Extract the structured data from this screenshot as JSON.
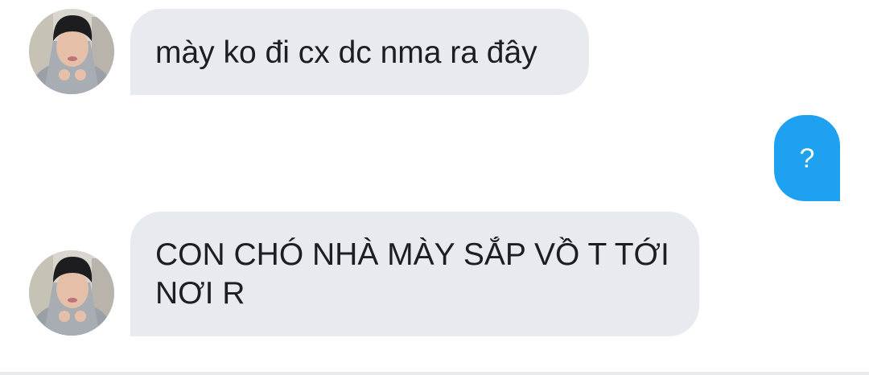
{
  "conversation": {
    "messages": [
      {
        "direction": "incoming",
        "text": "mày ko đi cx dc nma ra đây",
        "has_avatar": true
      },
      {
        "direction": "outgoing",
        "text": "?"
      },
      {
        "direction": "incoming",
        "text": "CON CHÓ NHÀ MÀY SẮP VỒ T TỚI\nNƠI R",
        "has_avatar": true
      }
    ]
  },
  "icons": {
    "avatar": "user-avatar-photo"
  },
  "colors": {
    "incoming_bubble": "#e7ebef",
    "outgoing_bubble": "#1ea1f1",
    "incoming_text": "#1b1e22",
    "outgoing_text": "#ffffff",
    "background": "#ffffff"
  }
}
